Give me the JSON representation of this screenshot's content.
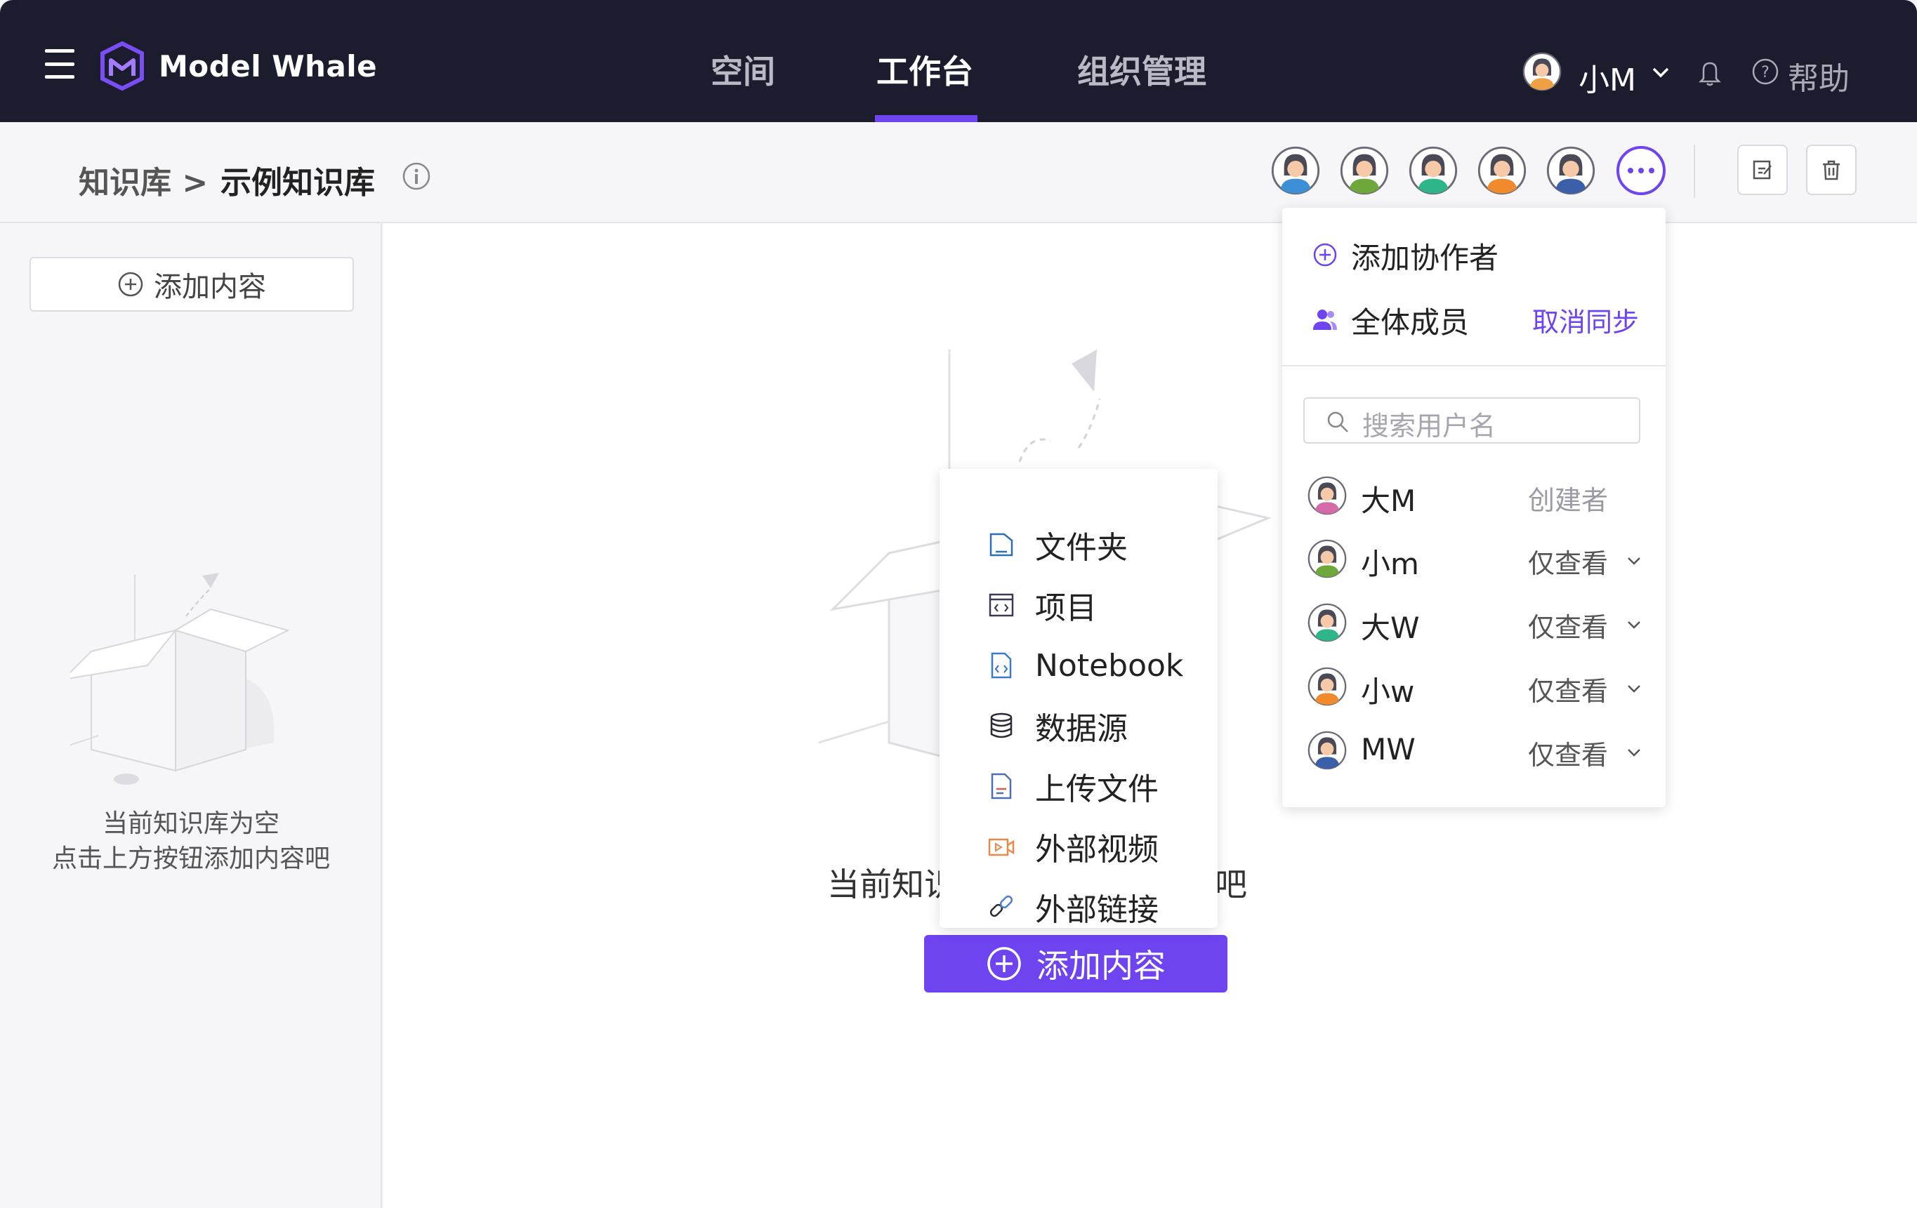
{
  "app": {
    "logo_text": "Model Whale",
    "accent_color": "#6e43f0",
    "nav_bg": "#1b1c2e"
  },
  "nav": {
    "tabs": [
      {
        "label": "空间",
        "active": false
      },
      {
        "label": "工作台",
        "active": true
      },
      {
        "label": "组织管理",
        "active": false
      }
    ],
    "user_name": "小M",
    "help_label": "帮助"
  },
  "breadcrumb": {
    "parent": "知识库 >",
    "current": "示例知识库"
  },
  "collaborator_avatars": [
    "avatar-1",
    "avatar-2",
    "avatar-3",
    "avatar-4",
    "avatar-5"
  ],
  "sidebar": {
    "add_label": "添加内容",
    "empty_line1": "当前知识库为空",
    "empty_line2": "点击上方按钮添加内容吧"
  },
  "main": {
    "empty_text": "当前知识库为空，添加文件吧",
    "add_button_label": "添加内容"
  },
  "add_menu": {
    "items": [
      {
        "label": "文件夹",
        "icon": "folder-icon"
      },
      {
        "label": "项目",
        "icon": "project-icon"
      },
      {
        "label": "Notebook",
        "icon": "notebook-icon"
      },
      {
        "label": "数据源",
        "icon": "database-icon"
      },
      {
        "label": "上传文件",
        "icon": "upload-file-icon"
      },
      {
        "label": "外部视频",
        "icon": "video-icon"
      },
      {
        "label": "外部链接",
        "icon": "link-icon"
      }
    ]
  },
  "collab_panel": {
    "add_collaborator": "添加协作者",
    "all_members": "全体成员",
    "cancel_sync": "取消同步",
    "search_placeholder": "搜索用户名",
    "members": [
      {
        "name": "大M",
        "role": "创建者",
        "editable": false
      },
      {
        "name": "小m",
        "role": "仅查看",
        "editable": true
      },
      {
        "name": "大W",
        "role": "仅查看",
        "editable": true
      },
      {
        "name": "小w",
        "role": "仅查看",
        "editable": true
      },
      {
        "name": "MW",
        "role": "仅查看",
        "editable": true
      }
    ]
  }
}
